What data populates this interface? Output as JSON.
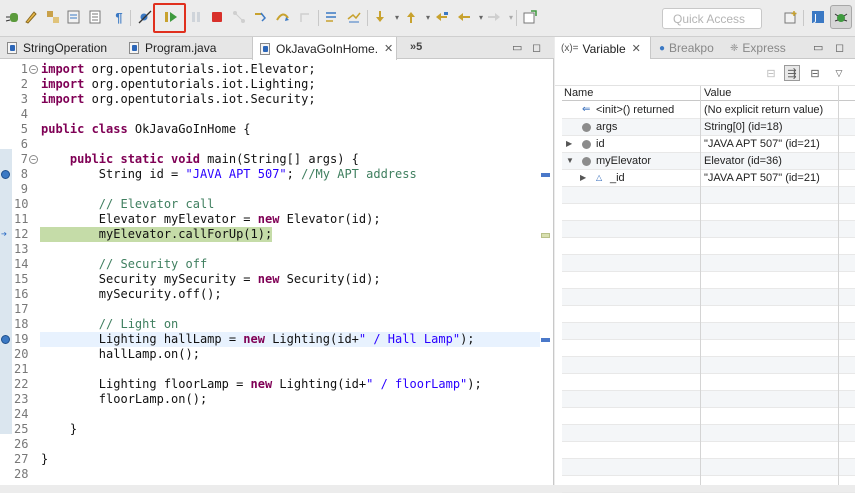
{
  "toolbar": {
    "icons": [
      "debug-icon",
      "highlight-icon",
      "sync-icon",
      "tasks-icon",
      "show-whitespace-icon",
      "skip-breakpoints-icon",
      "resume-icon",
      "suspend-icon",
      "terminate-icon",
      "disconnect-icon",
      "step-into-icon",
      "step-over-icon",
      "step-return-icon",
      "drop-to-frame-icon",
      "use-step-filters-icon",
      "next-annotation-icon",
      "prev-annotation-icon",
      "last-edit-icon",
      "back-icon",
      "forward-icon",
      "pin-icon"
    ],
    "quick_access_placeholder": "Quick Access",
    "perspectives": [
      "open-perspective-icon",
      "java-perspective-icon",
      "debug-perspective-icon"
    ]
  },
  "editor": {
    "tabs": [
      {
        "label": "StringOperation",
        "active": false
      },
      {
        "label": "Program.java",
        "active": false
      },
      {
        "label": "OkJavaGoInHome.",
        "active": true
      }
    ],
    "overflow_label": "»5",
    "lines": [
      {
        "n": "1",
        "fold": "−"
      },
      {
        "n": "2"
      },
      {
        "n": "3"
      },
      {
        "n": "4"
      },
      {
        "n": "5"
      },
      {
        "n": "6"
      },
      {
        "n": "7",
        "fold": "−"
      },
      {
        "n": "8",
        "breakpoint": true
      },
      {
        "n": "9"
      },
      {
        "n": "10"
      },
      {
        "n": "11"
      },
      {
        "n": "12",
        "current": true
      },
      {
        "n": "13"
      },
      {
        "n": "14"
      },
      {
        "n": "15"
      },
      {
        "n": "16"
      },
      {
        "n": "17"
      },
      {
        "n": "18"
      },
      {
        "n": "19",
        "breakpoint": true
      },
      {
        "n": "20"
      },
      {
        "n": "21"
      },
      {
        "n": "22"
      },
      {
        "n": "23"
      },
      {
        "n": "24"
      },
      {
        "n": "25"
      },
      {
        "n": "26"
      },
      {
        "n": "27"
      },
      {
        "n": "28"
      }
    ],
    "code": {
      "l1_kw": "import",
      "l1_rest": " org.opentutorials.iot.Elevator;",
      "l2_kw": "import",
      "l2_rest": " org.opentutorials.iot.Lighting;",
      "l3_kw": "import",
      "l3_rest": " org.opentutorials.iot.Security;",
      "l5_kw": "public class",
      "l5_rest": " OkJavaGoInHome {",
      "l7_indent": "    ",
      "l7_kw": "public static void",
      "l7_rest": " main(String[] args) {",
      "l8_a": "        String id = ",
      "l8_str": "\"JAVA APT 507\"",
      "l8_b": "; ",
      "l8_cm": "//My APT address",
      "l10_cm": "        // Elevator call",
      "l11_a": "        Elevator myElevator = ",
      "l11_kw": "new",
      "l11_b": " Elevator(id);",
      "l12_a": "        myElevator.callForUp(1);",
      "l14_cm": "        // Security off",
      "l15_a": "        Security mySecurity = ",
      "l15_kw": "new",
      "l15_b": " Security(id);",
      "l16_a": "        mySecurity.off();",
      "l18_cm": "        // Light on",
      "l19_a": "        Lighting hallLamp = ",
      "l19_kw": "new",
      "l19_b": " Lighting(id+",
      "l19_str": "\" / Hall Lamp\"",
      "l19_c": ");",
      "l20_a": "        hallLamp.on();",
      "l22_a": "        Lighting floorLamp = ",
      "l22_kw": "new",
      "l22_b": " Lighting(id+",
      "l22_str": "\" / floorLamp\"",
      "l22_c": ");",
      "l23_a": "        floorLamp.on();",
      "l25_a": "    }",
      "l27_a": "}"
    }
  },
  "variables": {
    "tabs": [
      {
        "label": "Variable",
        "icon": "(x)=",
        "active": true
      },
      {
        "label": "Breakpo",
        "active": false
      },
      {
        "label": "Express",
        "active": false
      }
    ],
    "columns": {
      "name": "Name",
      "value": "Value"
    },
    "rows": [
      {
        "name": "<init>() returned",
        "value": "(No explicit return value)",
        "kind": "return"
      },
      {
        "name": "args",
        "value": "String[0]  (id=18)",
        "kind": "local"
      },
      {
        "name": "id",
        "value": "\"JAVA APT 507\" (id=21)",
        "kind": "local",
        "expand": "▶"
      },
      {
        "name": "myElevator",
        "value": "Elevator  (id=36)",
        "kind": "local",
        "expand": "▼"
      },
      {
        "name": "_id",
        "value": "\"JAVA APT 507\" (id=21)",
        "kind": "field",
        "expand": "▶"
      }
    ]
  },
  "colors": {
    "keyword": "#7f0055",
    "string": "#2a00ff",
    "comment": "#3f7f5f",
    "current_line": "#c5dca8",
    "highlight_box": "#e0301e"
  }
}
